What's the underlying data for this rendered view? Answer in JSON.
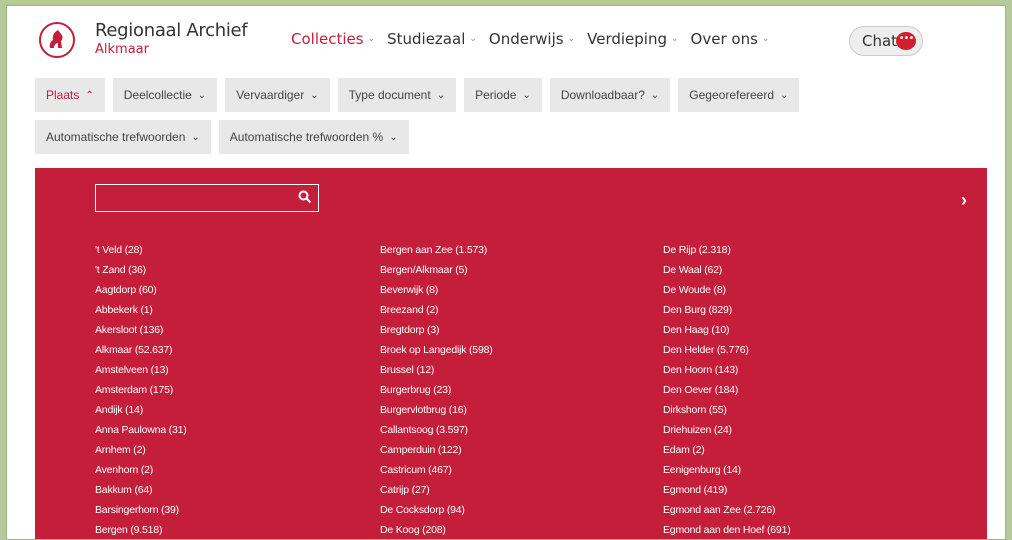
{
  "brand": {
    "name": "Regionaal Archief",
    "sub": "Alkmaar"
  },
  "nav": [
    {
      "label": "Collecties",
      "active": true
    },
    {
      "label": "Studiezaal",
      "active": false
    },
    {
      "label": "Onderwijs",
      "active": false
    },
    {
      "label": "Verdieping",
      "active": false
    },
    {
      "label": "Over ons",
      "active": false
    }
  ],
  "chat": {
    "label": "Chat",
    "bubble": "•••"
  },
  "filters": {
    "row1": [
      "Plaats",
      "Deelcollectie",
      "Vervaardiger",
      "Type document",
      "Periode",
      "Downloadbaar?",
      "Gegeorefereerd"
    ],
    "row2": [
      "Automatische trefwoorden",
      "Automatische trefwoorden %"
    ]
  },
  "panel": {
    "search_value": "",
    "next": "›",
    "columns": [
      [
        "'t Veld (28)",
        "'t Zand (36)",
        "Aagtdorp (60)",
        "Abbekerk (1)",
        "Akersloot (136)",
        "Alkmaar (52.637)",
        "Amstelveen (13)",
        "Amsterdam (175)",
        "Andijk (14)",
        "Anna Paulowna (31)",
        "Arnhem (2)",
        "Avenhorn (2)",
        "Bakkum (64)",
        "Barsingerhorn (39)",
        "Bergen (9.518)"
      ],
      [
        "Bergen aan Zee (1.573)",
        "Bergen/Alkmaar (5)",
        "Beverwijk (8)",
        "Breezand (2)",
        "Bregtdorp (3)",
        "Broek op Langedijk (598)",
        "Brussel (12)",
        "Burgerbrug (23)",
        "Burgervlotbrug (16)",
        "Callantsoog (3.597)",
        "Camperduin (122)",
        "Castricum (467)",
        "Catrijp (27)",
        "De Cocksdorp (94)",
        "De Koog (208)"
      ],
      [
        "De Rijp (2.318)",
        "De Waal (62)",
        "De Woude (8)",
        "Den Burg (829)",
        "Den Haag (10)",
        "Den Helder (5.776)",
        "Den Hoorn (143)",
        "Den Oever (184)",
        "Dirkshorn (55)",
        "Driehuizen (24)",
        "Edam (2)",
        "Eenigenburg (14)",
        "Egmond (419)",
        "Egmond aan Zee (2.726)",
        "Egmond aan den Hoef (691)"
      ]
    ]
  },
  "colors": {
    "accent": "#c41e3a",
    "filter_bg": "#e8e8e8",
    "outer_bg": "#b5c99a"
  }
}
